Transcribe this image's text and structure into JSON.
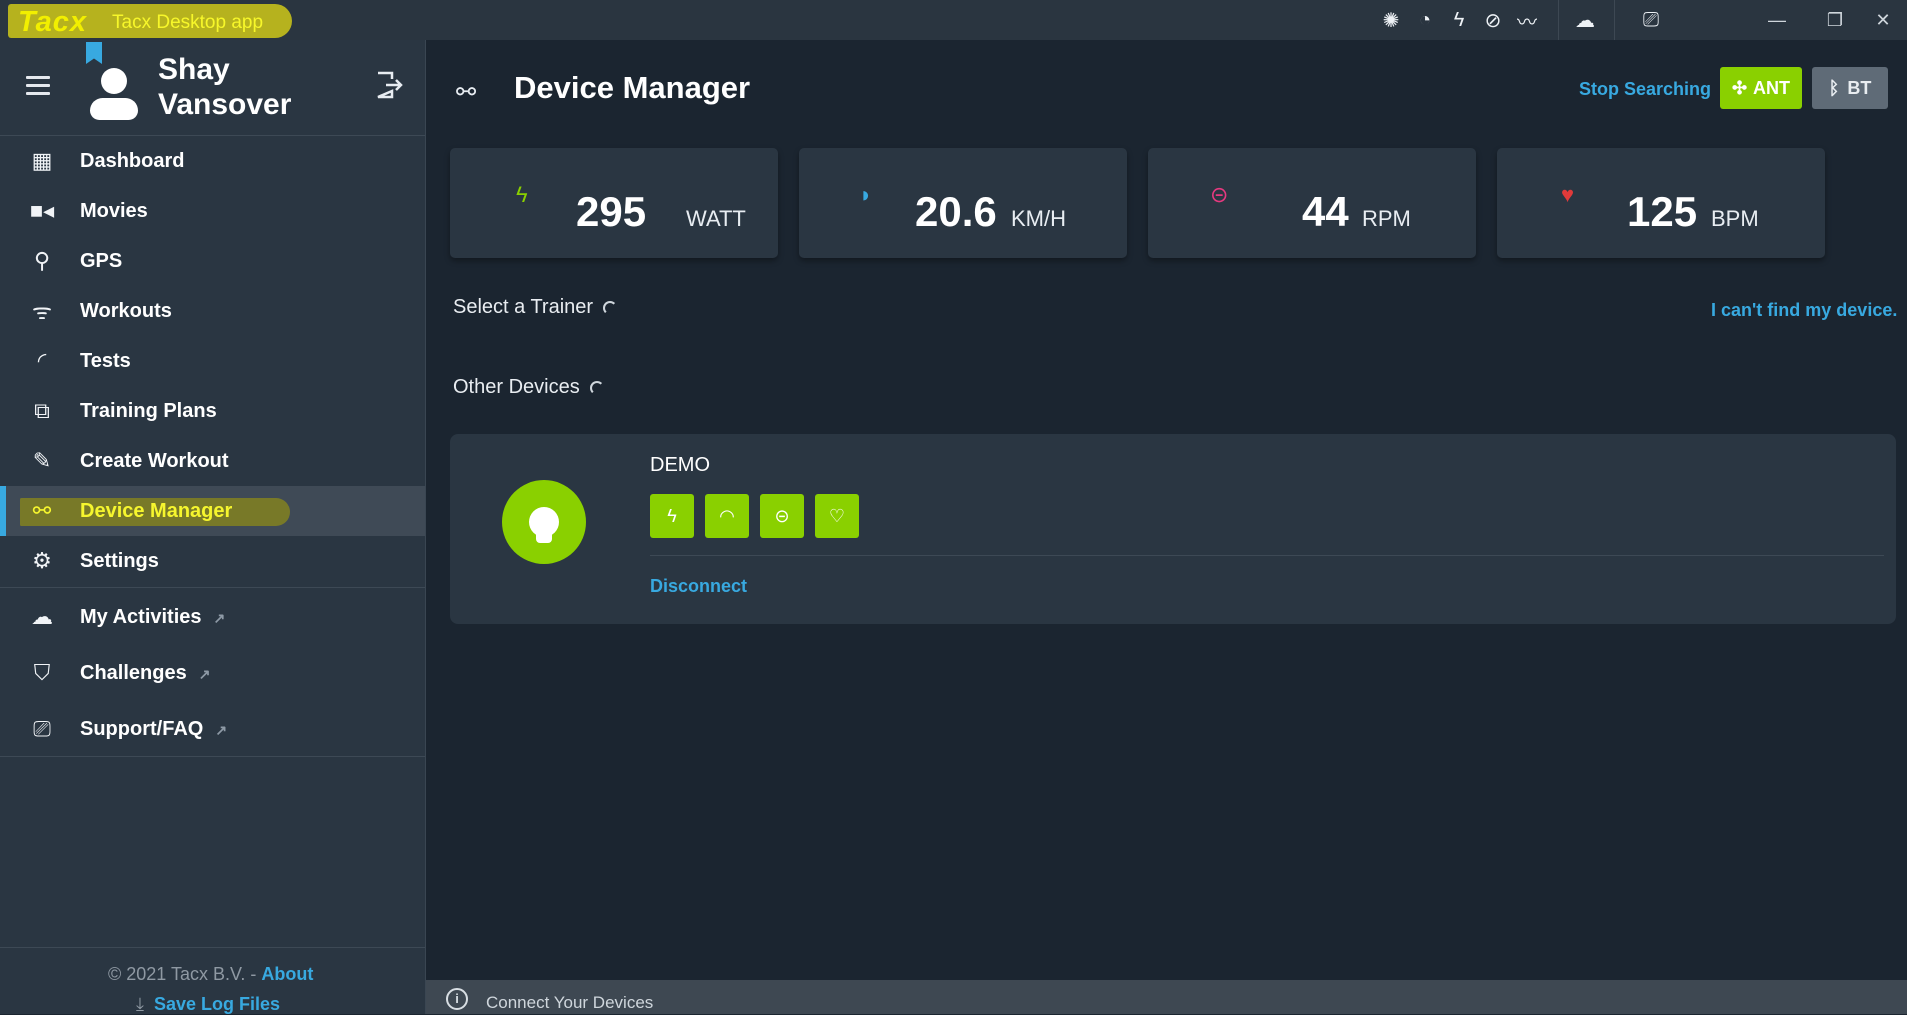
{
  "titlebar": {
    "logo": "Tacx",
    "app_title": "Tacx Desktop app",
    "status_icons": [
      "gear-icon",
      "speedometer-icon",
      "lightning-icon",
      "cadence-icon",
      "heartbeat-icon"
    ],
    "cloud_icon": "cloud-icon",
    "support_icon": "support-icon"
  },
  "profile": {
    "first_name": "Shay",
    "last_name": "Vansover"
  },
  "nav": [
    {
      "label": "Dashboard",
      "icon": "dashboard-icon"
    },
    {
      "label": "Movies",
      "icon": "video-icon"
    },
    {
      "label": "GPS",
      "icon": "map-pin-icon"
    },
    {
      "label": "Workouts",
      "icon": "bike-icon"
    },
    {
      "label": "Tests",
      "icon": "gauge-icon"
    },
    {
      "label": "Training Plans",
      "icon": "cards-icon"
    },
    {
      "label": "Create Workout",
      "icon": "pencil-icon"
    },
    {
      "label": "Device Manager",
      "icon": "link-icon",
      "active": true
    },
    {
      "label": "Settings",
      "icon": "gears-icon"
    },
    {
      "label": "My Activities",
      "icon": "cloud-icon",
      "external": true
    },
    {
      "label": "Challenges",
      "icon": "shield-icon",
      "external": true
    },
    {
      "label": "Support/FAQ",
      "icon": "support-icon",
      "external": true
    }
  ],
  "footer": {
    "copyright": "© 2021 Tacx B.V.  -",
    "about": "About",
    "save_log": "Save Log Files"
  },
  "main": {
    "title": "Device Manager",
    "stop_searching": "Stop Searching",
    "ant_label": "ANT",
    "bt_label": "BT",
    "stats": [
      {
        "value": "295",
        "unit": "WATT",
        "icon": "lightning-icon",
        "color": "#8ad000"
      },
      {
        "value": "20.6",
        "unit": "KM/H",
        "icon": "speedometer-icon",
        "color": "#38a9e0"
      },
      {
        "value": "44",
        "unit": "RPM",
        "icon": "cadence-icon",
        "color": "#e6397f"
      },
      {
        "value": "125",
        "unit": "BPM",
        "icon": "heart-icon",
        "color": "#e03a3a"
      }
    ],
    "select_trainer": "Select a Trainer",
    "cant_find": "I can't find my device.",
    "other_devices": "Other Devices",
    "device": {
      "name": "DEMO",
      "disconnect": "Disconnect",
      "capabilities": [
        "lightning-icon",
        "speedometer-icon",
        "cadence-icon",
        "heartbeat-icon"
      ]
    },
    "status_text": "Connect Your Devices"
  },
  "colors": {
    "accent_blue": "#38a9e0",
    "accent_green": "#8ad000",
    "sidebar_bg": "#2a3642",
    "main_bg": "#1b2530"
  }
}
